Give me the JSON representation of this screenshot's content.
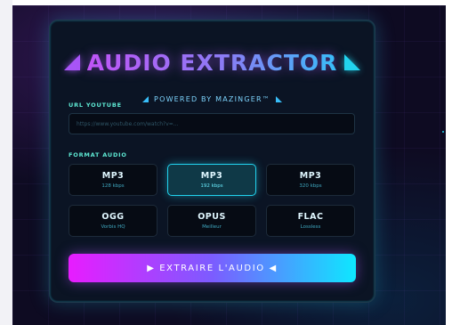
{
  "header": {
    "title": "AUDIO EXTRACTOR",
    "subtitle": "POWERED BY MAZINGER™"
  },
  "url_section": {
    "label": "URL YOUTUBE",
    "placeholder": "https://www.youtube.com/watch?v=...",
    "value": ""
  },
  "format_section": {
    "label": "FORMAT AUDIO",
    "selected": "MP3 192 kbps",
    "options": [
      {
        "name": "MP3",
        "detail": "128 kbps"
      },
      {
        "name": "MP3",
        "detail": "192 kbps"
      },
      {
        "name": "MP3",
        "detail": "320 kbps"
      },
      {
        "name": "OGG",
        "detail": "Vorbis HQ"
      },
      {
        "name": "OPUS",
        "detail": "Meilleur"
      },
      {
        "name": "FLAC",
        "detail": "Lossless"
      }
    ]
  },
  "actions": {
    "extract_label": "▶ EXTRAIRE L'AUDIO ◀"
  },
  "colors": {
    "accent_cyan": "#22d3ee",
    "accent_purple": "#a855f7",
    "accent_magenta": "#e81cff",
    "background": "#0e0b22",
    "panel": "#0b1424"
  }
}
